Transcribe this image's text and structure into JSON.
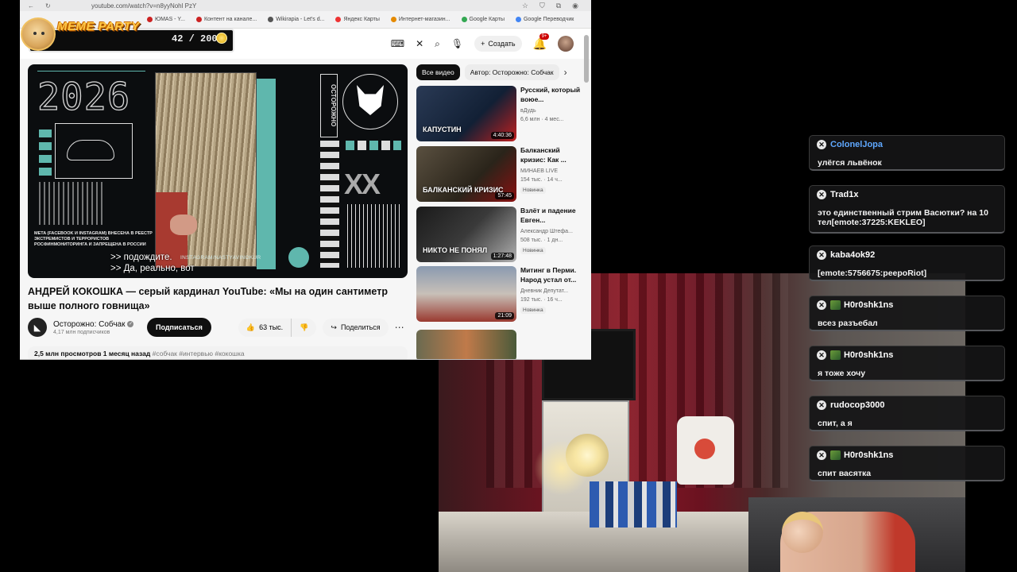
{
  "browser": {
    "url": "youtube.com/watch?v=n8yyNohl PzY",
    "bookmarks": [
      {
        "label": "ЮМАS - Y...",
        "color": "#cc2222"
      },
      {
        "label": "Контент на канале...",
        "color": "#cc2222"
      },
      {
        "label": "Wikirapia - Let's d...",
        "color": "#555555"
      },
      {
        "label": "Яндекс Карты",
        "color": "#e33"
      },
      {
        "label": "Интернет-магазин...",
        "color": "#e58a00"
      },
      {
        "label": "Google Карты",
        "color": "#34a853"
      },
      {
        "label": "Google Переводчик",
        "color": "#4285f4"
      }
    ]
  },
  "youtube": {
    "create_label": "Создать",
    "notif_count": "9+",
    "player": {
      "year_text": "2026",
      "vertical_text": "ОСТОРОЖНО",
      "meta_text": "META (FACEBOOK И INSTAGRAM) ВНЕСЕНА В РЕЕСТР ЭКСТРЕМИСТОВ И ТЕРРОРИСТОВ РОСФИНМОНИТОРИНГА И ЗАПРЕЩЕНА В РОССИИ",
      "watermark": "INSTAGRAM/NASTYAVINOKUR",
      "subtitle_line1": ">> подождите.",
      "subtitle_line2": ">> Да, реально, вот"
    },
    "video_title": "АНДРЕЙ КОКОШКА — серый кардинал YouTube: «Мы на один сантиметр выше полного говнища»",
    "channel_name": "Осторожно: Собчак",
    "subscribers": "4,17 млн подписчиков",
    "subscribe_label": "Подписаться",
    "likes": "63 тыс.",
    "share_label": "Поделиться",
    "views_date": "2,5 млн просмотров  1 месяц назад",
    "tags": "#собчак #интервью #кокошка",
    "chips": [
      "Все видео",
      "Автор: Осторожно: Собчак"
    ],
    "recommendations": [
      {
        "title": "Русский, который воюе...",
        "channel": "вДудь",
        "meta": "6,6 млн · 4 мес...",
        "duration": "4:40:36",
        "badge": "",
        "thumb_text": "КАПУСТИН",
        "thumb_bg": "linear-gradient(135deg,#2a3a55,#122035 60%,#c02020)"
      },
      {
        "title": "Балканский кризис: Как ...",
        "channel": "МИНАЕВ LIVE",
        "meta": "154 тыс. · 14 ч...",
        "duration": "57:45",
        "badge": "Новинка",
        "thumb_text": "БАЛКАНСКИЙ КРИЗИС",
        "thumb_bg": "linear-gradient(135deg,#5a5040,#2a241a 60%,#8a1010)"
      },
      {
        "title": "Взлёт и падение Евген...",
        "channel": "Александр Штефа...",
        "meta": "508 тыс. · 1 дн...",
        "duration": "1:27:48",
        "badge": "Новинка",
        "thumb_text": "НИКТО НЕ ПОНЯЛ",
        "thumb_bg": "linear-gradient(135deg,#1a1a1a,#3a3a3a 50%,#b0b0b0)"
      },
      {
        "title": "Митинг в Перми. Народ устал от...",
        "channel": "Дневник Депутат...",
        "meta": "192 тыс. · 16 ч...",
        "duration": "21:09",
        "badge": "Новинка",
        "thumb_text": "",
        "thumb_bg": "linear-gradient(180deg,#8a9ab0,#c8c0b8 50%,#9a3a30)"
      }
    ]
  },
  "overlay": {
    "title": "MEME PARTY",
    "counter": "42 / 200"
  },
  "chat": [
    {
      "user": "ColonelJopa",
      "color": "#5fa8ff",
      "text": "улёгся львёнок",
      "sub": false
    },
    {
      "user": "Trad1x",
      "color": "#ffffff",
      "text": "это единственный стрим Васютки? на 10 тел[emote:37225:KEKLEO]",
      "sub": false
    },
    {
      "user": "kaba4ok92",
      "color": "#ffffff",
      "text": "[emote:5756675:peepoRiot]",
      "sub": false
    },
    {
      "user": "H0r0shk1ns",
      "color": "#ffffff",
      "text": "всез разъебал",
      "sub": true
    },
    {
      "user": "H0r0shk1ns",
      "color": "#ffffff",
      "text": "я тоже хочу",
      "sub": true
    },
    {
      "user": "rudocop3000",
      "color": "#ffffff",
      "text": "спит, а я",
      "sub": false
    },
    {
      "user": "H0r0shk1ns",
      "color": "#ffffff",
      "text": "спит васятка",
      "sub": true
    }
  ]
}
